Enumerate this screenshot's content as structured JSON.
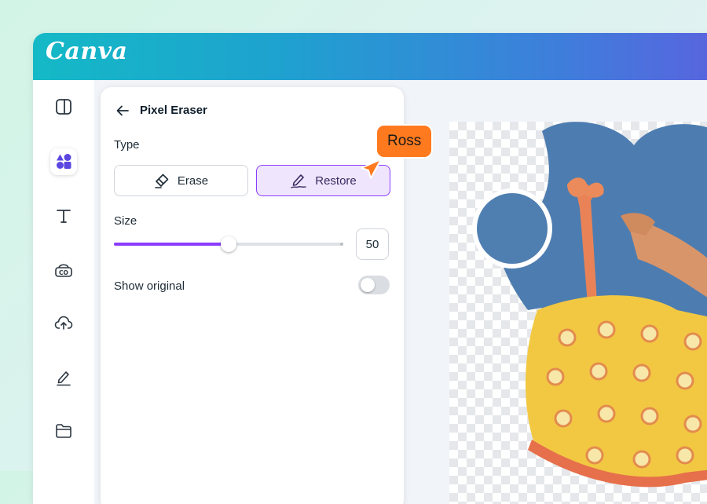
{
  "app": {
    "logo_text": "Canva"
  },
  "colors": {
    "accent": "#8b3dff",
    "brand_gradient_start": "#14b9c6",
    "brand_gradient_end": "#5a63df",
    "collaborator_tag": "#ff7a1f"
  },
  "sidebar": {
    "items": [
      {
        "icon": "layout-icon",
        "active": false
      },
      {
        "icon": "elements-icon",
        "active": true
      },
      {
        "icon": "text-icon",
        "active": false
      },
      {
        "icon": "brand-icon",
        "active": false
      },
      {
        "icon": "upload-icon",
        "active": false
      },
      {
        "icon": "draw-icon",
        "active": false
      },
      {
        "icon": "folder-icon",
        "active": false
      }
    ]
  },
  "panel": {
    "title": "Pixel Eraser",
    "type_label": "Type",
    "erase_label": "Erase",
    "restore_label": "Restore",
    "selected_type": "Restore",
    "size_label": "Size",
    "size_value": "50",
    "size_fraction": 0.5,
    "show_original_label": "Show original",
    "show_original_on": false
  },
  "collaborator": {
    "name": "Ross"
  }
}
